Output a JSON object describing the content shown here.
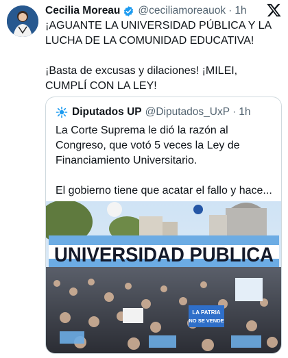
{
  "author": {
    "name": "Cecilia Moreau",
    "handle": "@ceciliamoreauok",
    "time": "1h"
  },
  "tweet": {
    "line1": "¡AGUANTE LA UNIVERSIDAD PÚBLICA Y LA LUCHA DE LA COMUNIDAD EDUCATIVA!",
    "line2": "¡Basta de excusas y dilaciones! ¡MILEI, CUMPLÍ CON LA LEY!"
  },
  "quote": {
    "name": "Diputados UP",
    "handle": "@Diputados_UxP",
    "time": "1h",
    "para1": "La Corte Suprema le dió la razón al Congreso, que votó 5 veces la Ley de Financiamiento Universitario.",
    "para2": "El gobierno tiene que acatar el fallo y hace...",
    "image": {
      "banner_text": "UNIVERSIDAD PUBLICA",
      "sign_text_1": "LA PATRIA",
      "sign_text_2": "NO SE VENDE"
    }
  },
  "icons": {
    "verified": "verified-badge-icon",
    "platform": "x-logo-icon"
  },
  "colors": {
    "verified_blue": "#1d9bf0",
    "secondary_text": "#536471",
    "border": "#cfd9de",
    "flag_blue": "#6cace4"
  }
}
